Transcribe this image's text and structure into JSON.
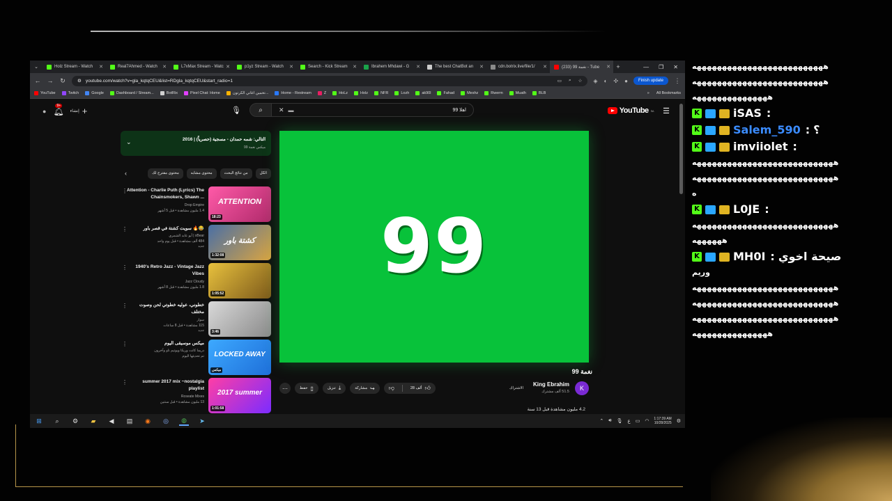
{
  "browser": {
    "tabs": [
      {
        "label": "Holz Stream - Watch",
        "color": "#53fc18"
      },
      {
        "label": "Real7Ahmed - Watch",
        "color": "#53fc18"
      },
      {
        "label": "L7xMax Stream - Watc",
        "color": "#53fc18"
      },
      {
        "label": "p1yz Stream - Watch",
        "color": "#53fc18"
      },
      {
        "label": "Search - Kick Stream",
        "color": "#53fc18"
      },
      {
        "label": "Ibrahem Mhdawi - G",
        "color": "#1aa34a"
      },
      {
        "label": "The best ChatBot an",
        "color": "#cccccc"
      },
      {
        "label": "cdn.botrix.live/file/1/",
        "color": "#8a8a8a"
      },
      {
        "label": "نغمة 99 (233) - Tube",
        "color": "#ff0000"
      }
    ],
    "url": "youtube.com/watch?v=gla_kqtqCEU&list=RDgla_kqtqCEU&start_radio=1",
    "finish_update": "Finish update",
    "bookmarks": [
      {
        "label": "YouTube",
        "color": "#ff0000"
      },
      {
        "label": "Twitch",
        "color": "#9146ff"
      },
      {
        "label": "Google",
        "color": "#4285f4"
      },
      {
        "label": "Dashboard / Stream...",
        "color": "#53fc18"
      },
      {
        "label": "BotRix",
        "color": "#d0d0d0"
      },
      {
        "label": "Pixel Chat: Home",
        "color": "#e040fb"
      },
      {
        "label": "تخمين اغاني الكرتون...",
        "color": "#ffb300"
      },
      {
        "label": "Home - Restream",
        "color": "#2979ff"
      },
      {
        "label": "Z",
        "color": "#e91e63"
      },
      {
        "label": "HoLz",
        "color": "#53fc18"
      },
      {
        "label": "Holz",
        "color": "#53fc18"
      },
      {
        "label": "NFR",
        "color": "#53fc18"
      },
      {
        "label": "Lozh",
        "color": "#53fc18"
      },
      {
        "label": "ak90l",
        "color": "#53fc18"
      },
      {
        "label": "Fahad",
        "color": "#53fc18"
      },
      {
        "label": "Meshz",
        "color": "#53fc18"
      },
      {
        "label": "Rwerm",
        "color": "#53fc18"
      },
      {
        "label": "Muath",
        "color": "#53fc18"
      },
      {
        "label": "BLB",
        "color": "#53fc18"
      }
    ],
    "all_bookmarks": "All Bookmarks"
  },
  "youtube": {
    "notif_count": "9+",
    "create_label": "إنشاء",
    "search_value": "اهلا 99",
    "logo_text": "YouTube",
    "logo_region": "SA",
    "playlist": {
      "title": "التالي: شمه حمدان - مسجية (حصرياً) | 2016",
      "subtitle": "ميكس نغمة 99"
    },
    "chips": [
      "الكل",
      "من نتائج البحث",
      "محتوى مشابه",
      "محتوى مقترح لك"
    ],
    "recommendations": [
      {
        "title": "Attention - Charlie Puth (Lyrics) The Chainsmokers, Shawn ...",
        "channel": "Drop Empire",
        "meta": "1.4 مليون مشاهدة • قبل 5 أشهر",
        "new": "",
        "duration": "18:23",
        "thumb_word": "ATTENTION",
        "thumb_bg": "linear-gradient(135deg,#ff5aa8,#b02a6b)"
      },
      {
        "title": "سويت كشتة في قصر باور 🔥😂",
        "channel": "أبو عابد الشمري | xBear",
        "meta": "484 ألف مشاهدة • قبل يوم واحد",
        "new": "جديد",
        "duration": "1:32:08",
        "thumb_word": "كشتة باور",
        "thumb_bg": "linear-gradient(135deg,#4a6fa5,#d9a441)"
      },
      {
        "title": "1940's Retro Jazz - Vintage Jazz Vibes",
        "channel": "Jazz Cloudy",
        "meta": "1.8 مليون مشاهدة • قبل 8 أشهر",
        "new": "",
        "duration": "1:05:52",
        "thumb_word": "",
        "thumb_bg": "linear-gradient(135deg,#e8c13d,#7d5a1b)"
      },
      {
        "title": "خطوني، عوليه خطوتي لحن وصوت مختلف",
        "channel": "سوار",
        "meta": "115 مشاهدة • قبل 8 ساعات",
        "new": "جديد",
        "duration": "3:46",
        "thumb_word": "",
        "thumb_bg": "linear-gradient(135deg,#d9d9d9,#8a8a8a)"
      },
      {
        "title": "ميكس موسيقى اليوم",
        "channel": "دريما كانت وريكا ويوتيم ناو وآخرون",
        "meta": "تم تحديثها اليوم",
        "new": "",
        "duration": "ميكس",
        "thumb_word": "LOCKED AWAY",
        "thumb_bg": "linear-gradient(135deg,#3da9ff,#1e6fd9)"
      },
      {
        "title": "summer 2017 mix ~nostalgia playlist",
        "channel": "Roseate Mixes",
        "meta": "13 مليون مشاهدة • قبل سنتين",
        "new": "",
        "duration": "1:01:58",
        "thumb_word": "2017 summer",
        "thumb_bg": "linear-gradient(135deg,#ff3ea5,#7b2cff)"
      }
    ],
    "player_text": "99",
    "video_title": "نغمة 99",
    "channel": {
      "initial": "K",
      "name": "King Ebrahim",
      "subs": "51.5 ألف مشترك",
      "join": "الاشتراك"
    },
    "actions": {
      "likes": "28 ألف",
      "share": "مشاركة",
      "download": "تنزيل",
      "save": "حفظ"
    },
    "views": "4.2 مليون مشاهدة قبل 13 سنة"
  },
  "taskbar": {
    "time": "1:17:39 AM",
    "date": "10/28/2025",
    "lang": "ع"
  },
  "chat": {
    "messages": [
      {
        "type": "text",
        "text": "ههههههههههههههههههههههههههه"
      },
      {
        "type": "text",
        "text": "ههههههههههههههههههههههههههه"
      },
      {
        "type": "text",
        "text": "هههههههههههههههه"
      },
      {
        "type": "user",
        "name": "iSAS",
        "name_color": "#ffffff",
        "after": ""
      },
      {
        "type": "user",
        "name": "Salem_590",
        "name_color": "#3b8cff",
        "after": "؟"
      },
      {
        "type": "user",
        "name": "imviiolet",
        "name_color": "#ffffff",
        "after": ""
      },
      {
        "type": "text",
        "text": "ههههههههههههههههههههههههههههه"
      },
      {
        "type": "text",
        "text": "ههههههههههههههههههههههههههههه"
      },
      {
        "type": "text",
        "text": "ه"
      },
      {
        "type": "user",
        "name": "L0JE",
        "name_color": "#ffffff",
        "after": ""
      },
      {
        "type": "text",
        "text": "ههههههههههههههههههههههههههههه"
      },
      {
        "type": "text",
        "text": "ههههههه"
      },
      {
        "type": "user",
        "name": "MH0I",
        "name_color": "#ffffff",
        "after": "صيحة اخوي"
      },
      {
        "type": "text",
        "text": "وريم"
      },
      {
        "type": "text",
        "text": "ههههههههههههههههههههههههههههه"
      },
      {
        "type": "text",
        "text": "ههههههههههههههههههههههههههههه"
      },
      {
        "type": "text",
        "text": "ههههههههههههههههههههههههههههه"
      },
      {
        "type": "text",
        "text": "هههههههههههههههه"
      }
    ]
  }
}
